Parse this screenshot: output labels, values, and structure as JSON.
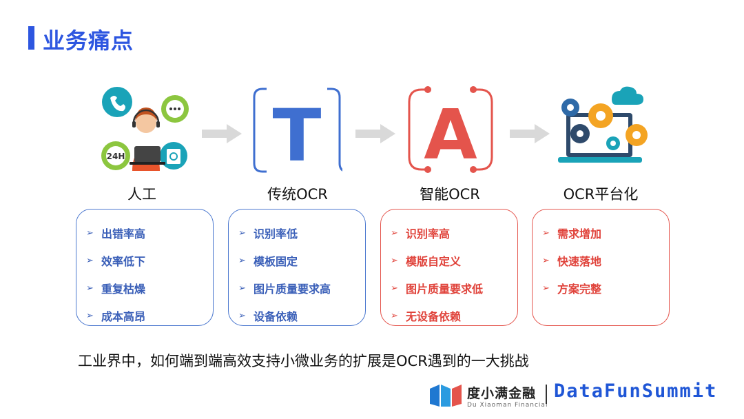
{
  "slide": {
    "title": "业务痛点",
    "bottom_text": "工业界中，如何端到端高效支持小微业务的扩展是OCR遇到的一大挑战"
  },
  "columns": [
    {
      "label": "人工",
      "style": "blue",
      "items": [
        "出错率高",
        "效率低下",
        "重复枯燥",
        "成本高昂"
      ]
    },
    {
      "label": "传统OCR",
      "style": "blue",
      "items": [
        "识别率低",
        "模板固定",
        "图片质量要求高",
        "设备依赖"
      ]
    },
    {
      "label": "智能OCR",
      "style": "red",
      "items": [
        "识别率高",
        "模版自定义",
        "图片质量要求低",
        "无设备依赖"
      ]
    },
    {
      "label": "OCR平台化",
      "style": "red",
      "items": [
        "需求增加",
        "快速落地",
        "方案完整"
      ]
    }
  ],
  "icons": {
    "t_letter": "T",
    "a_letter": "A",
    "clock_text": "24H"
  },
  "logo": {
    "brand_cn": "度小满金融",
    "brand_en": "Du Xiaoman Financial",
    "summit": "DataFunSummit"
  },
  "colors": {
    "accent_blue": "#2d56e0",
    "box_blue": "#4a77cf",
    "box_red": "#e4544c",
    "arrow_gray": "#d9d9d9"
  },
  "chevron": "➢"
}
